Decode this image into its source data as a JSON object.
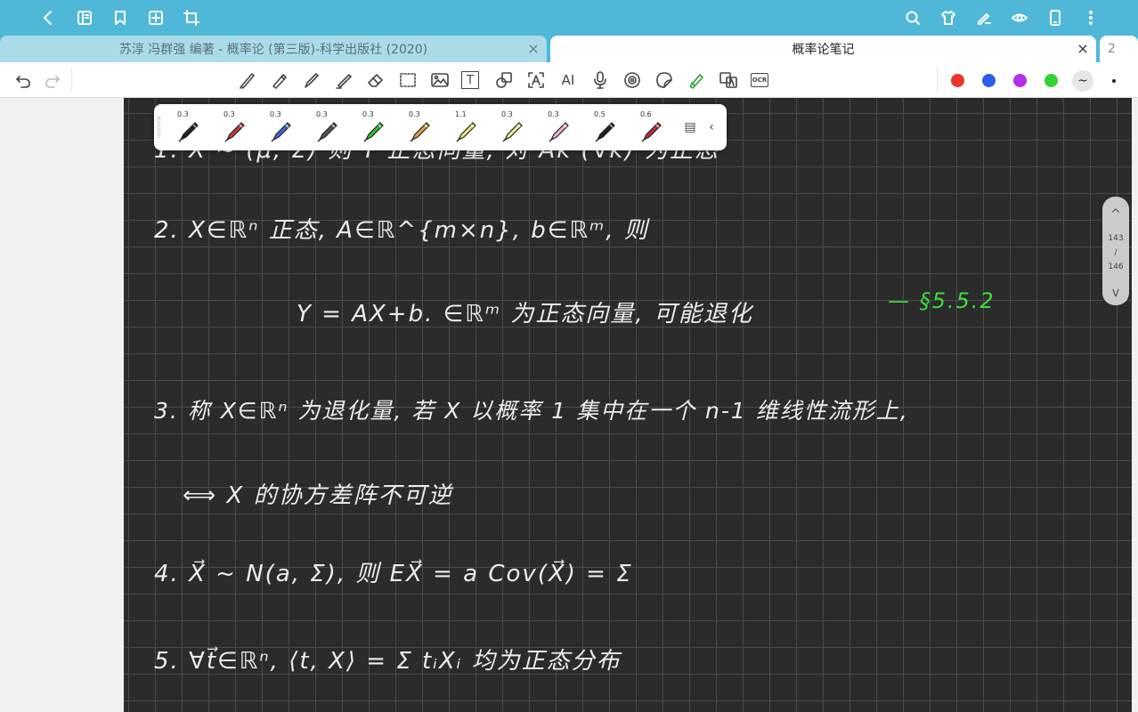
{
  "tabs": {
    "tab1_title": "苏淳 冯群强 编著 - 概率论 (第三版)-科学出版社 (2020)",
    "tab2_title": "概率论笔记",
    "tab3_label": "2",
    "close_glyph": "×"
  },
  "topbar_icons": [
    "back-icon",
    "book-icon",
    "bookmark-icon",
    "add-page-icon",
    "crop-icon",
    "search-icon",
    "shirt-icon",
    "pen-settings-icon",
    "eye-icon",
    "phone-icon",
    "more-icon"
  ],
  "toolbar": {
    "text_tool": "T",
    "ai_tool": "AI",
    "ocr_tool": "OCR",
    "colors": [
      "#e8352a",
      "#2a5ee8",
      "#b52ee8",
      "#33d233"
    ]
  },
  "palette": {
    "sizes": [
      "0.3",
      "0.3",
      "0.3",
      "0.3",
      "0.3",
      "0.3",
      "1.1",
      "0.3",
      "0.3",
      "0.5",
      "0.6"
    ],
    "pen_colors": [
      "#222222",
      "#c93a3a",
      "#3a6ec9",
      "#555555",
      "#2fbf2f",
      "#e0a04a",
      "#f2e47a",
      "#f2ec9a",
      "#f0b0d8",
      "#222222",
      "#c0303a"
    ]
  },
  "scroller": {
    "current": "143",
    "slash": "/",
    "total": "146"
  },
  "notes": {
    "line1": "1. X ~ (μ, Σ) 则 Y 正态向量, 对 Ak (∀k) 为正态",
    "line2": "2. X∈ℝⁿ 正态,   A∈ℝ^{m×n},   b∈ℝᵐ,  则",
    "line3": "Y = AX+b. ∈ℝᵐ   为正态向量, 可能退化",
    "line3_ref": "— §5.5.2",
    "line4": "3. 称 X∈ℝⁿ 为退化量, 若 X 以概率 1 集中在一个 n-1 维线性流形上,",
    "line5": "⟺   X 的协方差阵不可逆",
    "line6": "4.  X⃗ ~ N(a, Σ), 则 EX⃗ = a      Cov(X⃗) = Σ",
    "line7": "5.  ∀t⃗∈ℝⁿ,      ⟨t, X⟩ = Σ tᵢXᵢ   均为正态分布"
  }
}
